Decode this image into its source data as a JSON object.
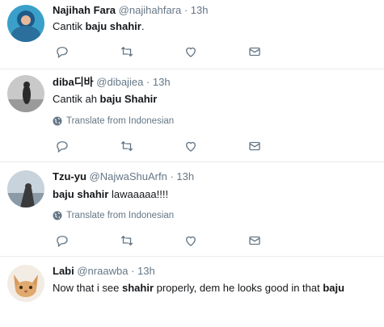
{
  "tweets": [
    {
      "name": "Najihah Fara",
      "handle": "@najihahfara",
      "dot": "·",
      "time": "13h",
      "text_parts": [
        "Cantik ",
        "baju shahir",
        "."
      ],
      "translate": ""
    },
    {
      "name": "diba디바",
      "handle": "@dibajiea",
      "dot": "·",
      "time": "13h",
      "text_parts": [
        "Cantik ah ",
        "baju Shahir",
        ""
      ],
      "translate": "Translate from Indonesian"
    },
    {
      "name": "Tzu-yu",
      "handle": "@NajwaShuArfn",
      "dot": "·",
      "time": "13h",
      "text_parts": [
        "",
        "baju shahir",
        " lawaaaaa!!!!"
      ],
      "translate": "Translate from Indonesian"
    },
    {
      "name": "Labi",
      "handle": "@nraawba",
      "dot": "·",
      "time": "13h",
      "text_parts": [
        "Now that i see ",
        "shahir",
        " properly, dem he looks good in that ",
        "baju"
      ],
      "translate": ""
    }
  ],
  "icons": {
    "reply": "reply-icon",
    "retweet": "retweet-icon",
    "like": "heart-icon",
    "dm": "envelope-icon",
    "translate": "globe-icon"
  },
  "colors": {
    "icon_gray": "#657786",
    "divider": "#e6ecf0",
    "text": "#14171a"
  }
}
